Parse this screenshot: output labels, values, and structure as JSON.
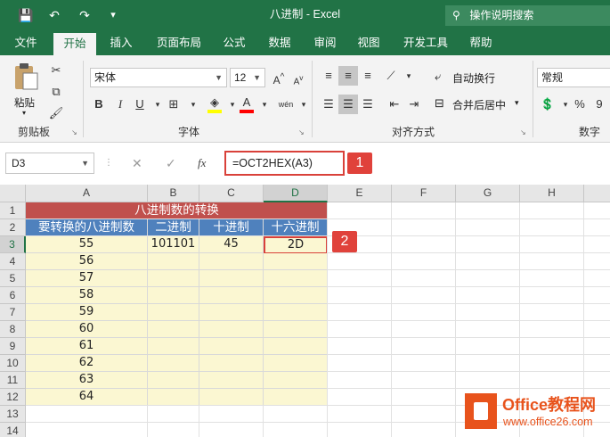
{
  "app": {
    "title": "八进制 - Excel",
    "tellme": "操作说明搜索",
    "quick_access": {
      "save": "💾",
      "undo": "↶",
      "redo": "↷",
      "customize": "▾"
    }
  },
  "tabs": [
    "文件",
    "开始",
    "插入",
    "页面布局",
    "公式",
    "数据",
    "审阅",
    "视图",
    "开发工具",
    "帮助"
  ],
  "active_tab": "开始",
  "ribbon": {
    "clipboard": {
      "paste": "粘贴",
      "group": "剪贴板"
    },
    "font": {
      "name": "宋体",
      "size": "12",
      "group": "字体",
      "bold": "B",
      "italic": "I",
      "underline": "U",
      "font_color": "A",
      "phonetic": "wén"
    },
    "alignment": {
      "wrap": "自动换行",
      "merge": "合并后居中",
      "group": "对齐方式"
    },
    "number": {
      "format": "常规",
      "percent": "%",
      "comma": "9",
      "group": "数字"
    }
  },
  "formula_bar": {
    "name_box": "D3",
    "cancel": "✕",
    "enter": "✓",
    "fx": "fx",
    "formula": "=OCT2HEX(A3)"
  },
  "callouts": [
    "1",
    "2"
  ],
  "columns": [
    "A",
    "B",
    "C",
    "D",
    "E",
    "F",
    "G",
    "H"
  ],
  "rows": [
    "1",
    "2",
    "3",
    "4",
    "5",
    "6",
    "7",
    "8",
    "9",
    "10",
    "11",
    "12",
    "13",
    "14"
  ],
  "sheet": {
    "title": "八进制数的转换",
    "headers": [
      "要转换的八进制数",
      "二进制",
      "十进制",
      "十六进制"
    ],
    "octal_values": [
      "55",
      "56",
      "57",
      "58",
      "59",
      "60",
      "61",
      "62",
      "63",
      "64"
    ],
    "row3": {
      "binary": "101101",
      "decimal": "45",
      "hex": "2D"
    }
  },
  "watermark": {
    "line1": "Office教程网",
    "line2": "www.office26.com"
  },
  "colors": {
    "excel_green": "#217346",
    "title_red": "#c0504d",
    "header_blue": "#4f81bd",
    "cell_yellow": "#fbf7d2",
    "callout_red": "#e0423b"
  }
}
